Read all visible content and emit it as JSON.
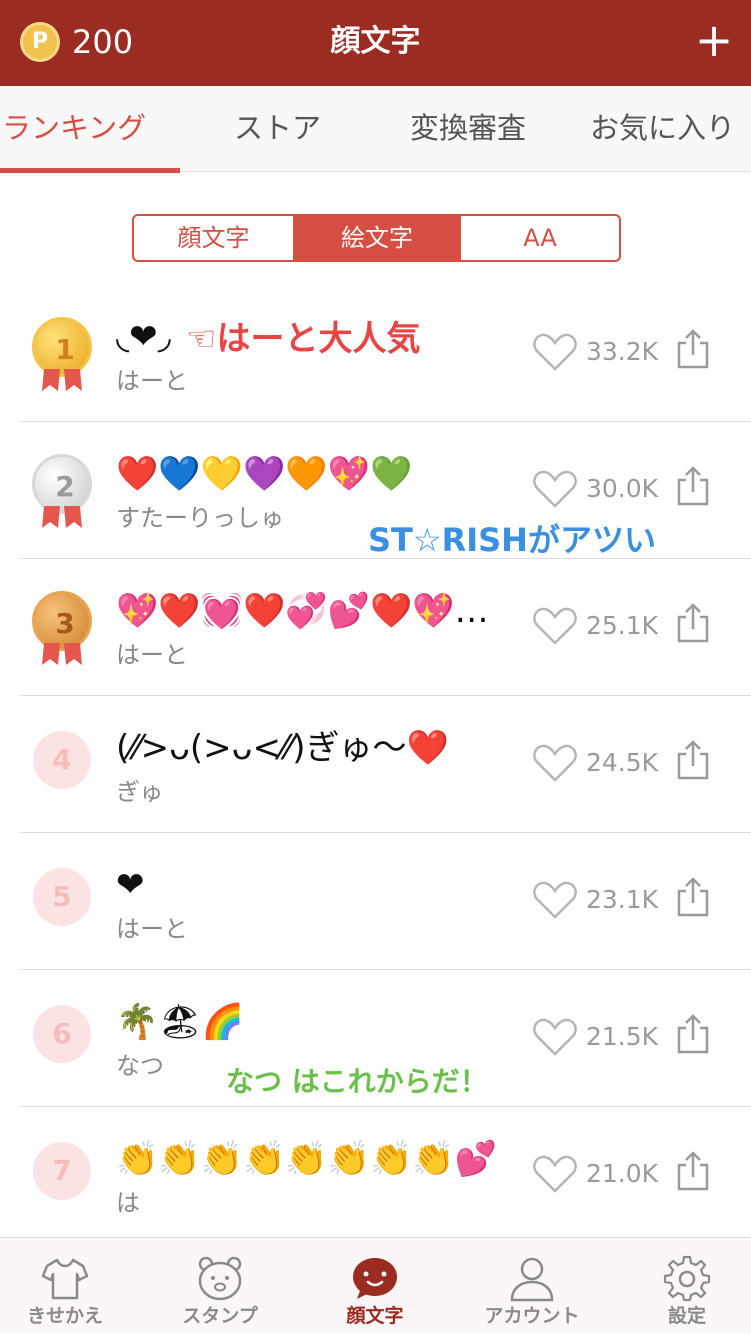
{
  "header": {
    "coin_letter": "P",
    "coin_amount": "200",
    "title": "顔文字",
    "add_label": "+"
  },
  "tabs": [
    {
      "label": "ランキング",
      "active": true
    },
    {
      "label": "ストア",
      "active": false
    },
    {
      "label": "変換審査",
      "active": false
    },
    {
      "label": "お気に入り",
      "active": false
    }
  ],
  "segments": [
    {
      "label": "顔文字",
      "selected": false
    },
    {
      "label": "絵文字",
      "selected": true
    },
    {
      "label": "AA",
      "selected": false
    }
  ],
  "ranking": [
    {
      "rank": "1",
      "kaomoji": "◟❤◞",
      "label": "はーと",
      "likes": "33.2K",
      "medal": "gold"
    },
    {
      "rank": "2",
      "kaomoji": "❤️💙💛💜🧡💖💚",
      "label": "すたーりっしゅ",
      "likes": "30.0K",
      "medal": "silver"
    },
    {
      "rank": "3",
      "kaomoji": "💖❤️💓❤️💞💕❤️💖…",
      "label": "はーと",
      "likes": "25.1K",
      "medal": "bronze"
    },
    {
      "rank": "4",
      "kaomoji": "(⁄⁄>ᴗ(>ᴗ<⁄⁄)ぎゅ〜❤️",
      "label": "ぎゅ",
      "likes": "24.5K",
      "medal": "none"
    },
    {
      "rank": "5",
      "kaomoji": "❤",
      "label": "はーと",
      "likes": "23.1K",
      "medal": "none"
    },
    {
      "rank": "6",
      "kaomoji": "🌴🏖🌈",
      "label": "なつ",
      "likes": "21.5K",
      "medal": "none"
    },
    {
      "rank": "7",
      "kaomoji": "👏👏👏👏👏👏👏👏💕",
      "label": "は",
      "likes": "21.0K",
      "medal": "none"
    }
  ],
  "annotations": {
    "first": "☜はーと大人気",
    "second": "ST☆RISHがアツい",
    "third": "なつ はこれからだ！"
  },
  "bottom_nav": [
    {
      "label": "きせかえ",
      "icon": "tshirt-icon",
      "active": false
    },
    {
      "label": "スタンプ",
      "icon": "bear-icon",
      "active": false
    },
    {
      "label": "顔文字",
      "icon": "smile-bubble-icon",
      "active": true
    },
    {
      "label": "アカウント",
      "icon": "person-icon",
      "active": false
    },
    {
      "label": "設定",
      "icon": "gear-icon",
      "active": false
    }
  ],
  "colors": {
    "header_bg": "#9b2c22",
    "accent": "#d64e44",
    "rank_circle_bg": "#fbe3e3",
    "annotation_red": "#e84444",
    "annotation_blue": "#3a8fe0",
    "annotation_green": "#6bc04a"
  }
}
